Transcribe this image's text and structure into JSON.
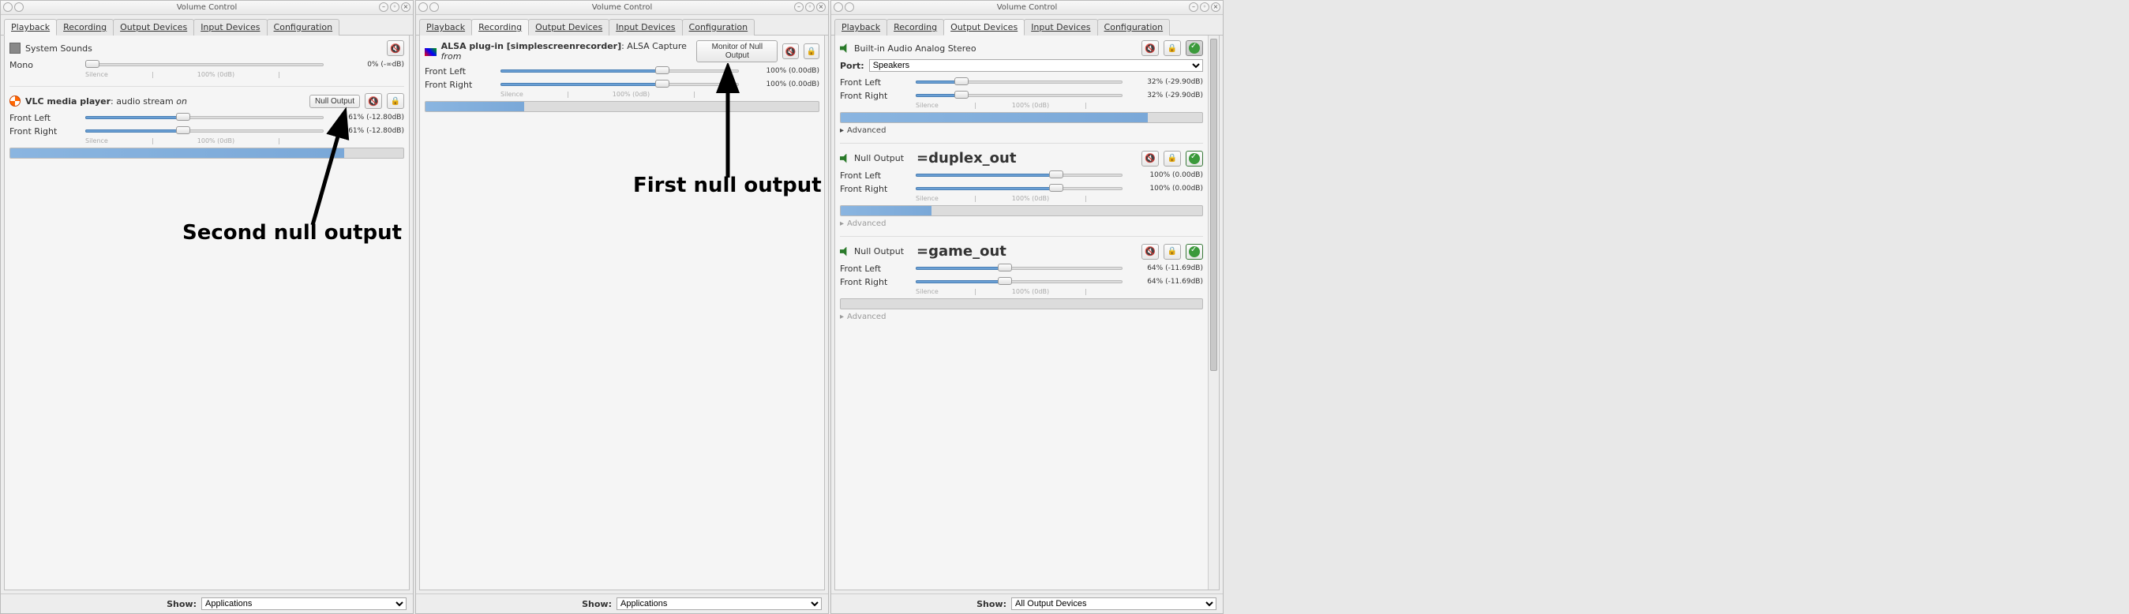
{
  "window_title": "Volume Control",
  "tabs": {
    "playback": "Playback",
    "recording": "Recording",
    "output_devices": "Output Devices",
    "input_devices": "Input Devices",
    "configuration": "Configuration"
  },
  "footer_label": "Show:",
  "footer_options": {
    "applications": "Applications",
    "all_output": "All Output Devices"
  },
  "ticks": {
    "silence": "Silence",
    "center": "100% (0dB)"
  },
  "labels": {
    "front_left": "Front Left",
    "front_right": "Front Right",
    "mono": "Mono",
    "port": "Port:",
    "speakers": "Speakers",
    "advanced": "Advanced"
  },
  "playback": {
    "system_sounds": {
      "name": "System Sounds",
      "mono_value": "0% (-∞dB)",
      "mono_pct": 0
    },
    "vlc": {
      "name": "VLC media player",
      "desc": ": audio stream ",
      "state": "on",
      "output_btn": "Null Output",
      "left_value": "61% (-12.80dB)",
      "right_value": "61% (-12.80dB)",
      "pct": 41,
      "vu_pct": 85
    }
  },
  "recording": {
    "ssr": {
      "name": "ALSA plug-in [simplescreenrecorder]",
      "desc": ": ALSA Capture ",
      "state": "from",
      "monitor_btn": "Monitor of Null Output",
      "left_value": "100% (0.00dB)",
      "right_value": "100% (0.00dB)",
      "pct": 68,
      "vu_pct": 25
    }
  },
  "output_devices": {
    "builtin": {
      "name": "Built-in Audio Analog Stereo",
      "left_value": "32% (-29.90dB)",
      "right_value": "32% (-29.90dB)",
      "pct": 22,
      "vu_pct": 85
    },
    "null1": {
      "name": "Null Output",
      "alias": "=duplex_out",
      "left_value": "100% (0.00dB)",
      "right_value": "100% (0.00dB)",
      "pct": 68,
      "vu_pct": 25
    },
    "null2": {
      "name": "Null Output",
      "alias": "=game_out",
      "left_value": "64% (-11.69dB)",
      "right_value": "64% (-11.69dB)",
      "pct": 43,
      "vu_pct": 0
    }
  },
  "annotations": {
    "first": "First null output",
    "second": "Second null output"
  }
}
